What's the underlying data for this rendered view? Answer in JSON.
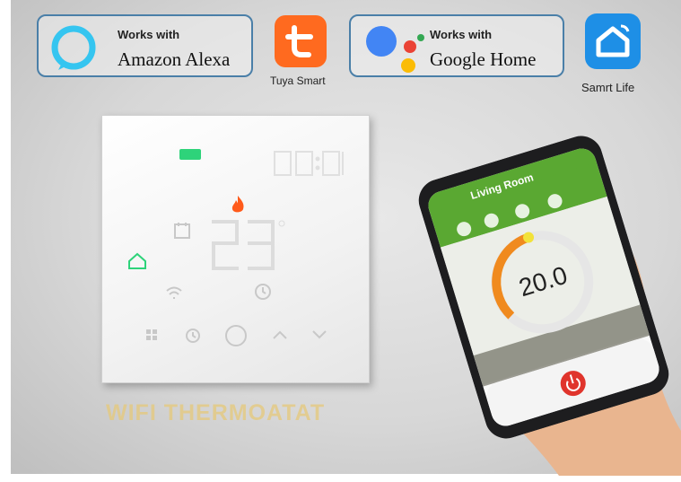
{
  "badges": {
    "alexa": {
      "line1": "Works with",
      "line2": "Amazon Alexa"
    },
    "tuya": {
      "caption": "Tuya Smart"
    },
    "google": {
      "line1": "Works with",
      "line2": "Google Home"
    },
    "smartlife": {
      "caption": "Samrt Life"
    }
  },
  "thermostat": {
    "product_label": "WIFI THERMOATAT"
  },
  "app": {
    "room_title": "Living Room",
    "temperature": "20.0"
  },
  "colors": {
    "badge_border": "#4a7fa8",
    "tuya_orange": "#ff6a1f",
    "smartlife_blue": "#1e8fe6",
    "app_green": "#5aa832",
    "gauge_orange": "#f08a1e",
    "label_gold": "#e6c97a"
  }
}
